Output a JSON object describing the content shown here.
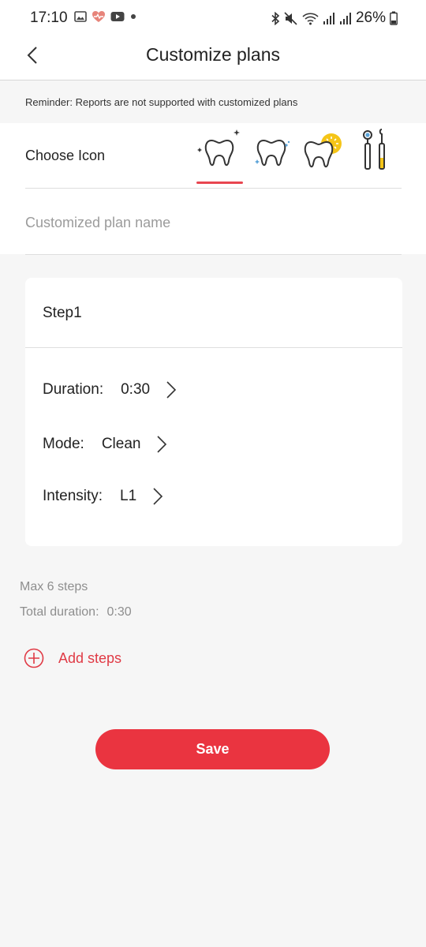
{
  "status_bar": {
    "time": "17:10",
    "battery": "26%",
    "left_icons": [
      "gallery-icon",
      "heart-rate-icon",
      "youtube-icon",
      "dot-icon"
    ],
    "right_icons": [
      "bluetooth-icon",
      "mute-icon",
      "wifi-icon",
      "signal-icon",
      "signal-icon",
      "battery-icon"
    ]
  },
  "header": {
    "title": "Customize plans",
    "back_icon": "chevron-left-icon"
  },
  "reminder": "Reminder: Reports are not supported with customized plans",
  "icon_picker": {
    "label": "Choose Icon",
    "options": [
      "sparkling-tooth-icon",
      "clean-tooth-icon",
      "whitening-tooth-icon",
      "dental-tools-icon"
    ],
    "selected_index": 0
  },
  "plan_name": {
    "placeholder": "Customized plan name",
    "value": ""
  },
  "step": {
    "title": "Step1",
    "duration_label": "Duration:",
    "duration_value": "0:30",
    "mode_label": "Mode:",
    "mode_value": "Clean",
    "intensity_label": "Intensity:",
    "intensity_value": "L1"
  },
  "summary": {
    "max_steps": "Max 6 steps",
    "total_duration_label": "Total duration:",
    "total_duration_value": "0:30"
  },
  "add_steps_label": "Add steps",
  "save_label": "Save",
  "colors": {
    "accent": "#ea3440",
    "background": "#f6f6f6",
    "card": "#ffffff"
  }
}
